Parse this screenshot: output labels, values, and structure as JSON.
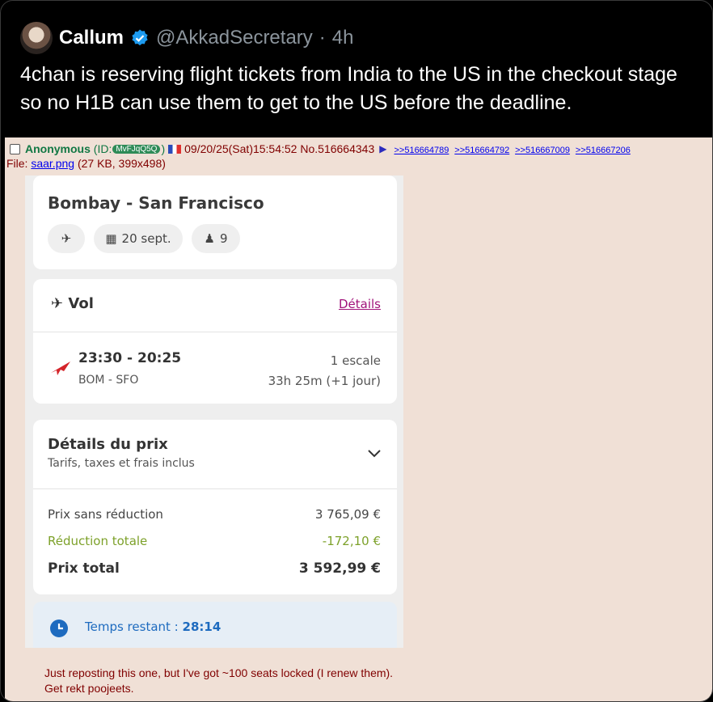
{
  "tweet": {
    "author": "Callum",
    "handle": "@AkkadSecretary",
    "time": "4h",
    "text": "4chan is reserving flight tickets from India to the US in the checkout stage so no H1B can use them to get to the US before the deadline."
  },
  "post": {
    "name": "Anonymous",
    "id_prefix": "(ID:",
    "poster_id": "MvFJqQ5Q",
    "id_suffix": ")",
    "datetime": "09/20/25(Sat)15:54:52",
    "post_no": "No.516664343",
    "replies": [
      ">>516664789",
      ">>516664792",
      ">>516667009",
      ">>516667206"
    ],
    "file_label": "File:",
    "file_name": "saar.png",
    "file_meta": "(27 KB, 399x498)",
    "comment_line1": "Just reposting this one, but I've got ~100 seats locked (I renew them).",
    "comment_line2": "Get rekt poojeets."
  },
  "booking": {
    "route": "Bombay - San Francisco",
    "date": "20 sept.",
    "passengers": "9",
    "flight_label": "Vol",
    "details_link": "Détails",
    "times": "23:30 - 20:25",
    "airports": "BOM - SFO",
    "stops": "1 escale",
    "duration": "33h 25m (+1 jour)",
    "price_title": "Détails du prix",
    "price_subtitle": "Tarifs, taxes et frais inclus",
    "price_rows": [
      {
        "label": "Prix sans réduction",
        "value": "3 765,09 €"
      },
      {
        "label": "Réduction totale",
        "value": "-172,10 €"
      },
      {
        "label": "Prix total",
        "value": "3 592,99 €"
      }
    ],
    "timer_label": "Temps restant :",
    "timer_value": "28:14"
  },
  "colors": {
    "verified": "#1d9bf0",
    "chan_bg": "#f0e0d6",
    "link": "#a0127a",
    "discount": "#7da12a",
    "timer": "#1e6bbf"
  }
}
